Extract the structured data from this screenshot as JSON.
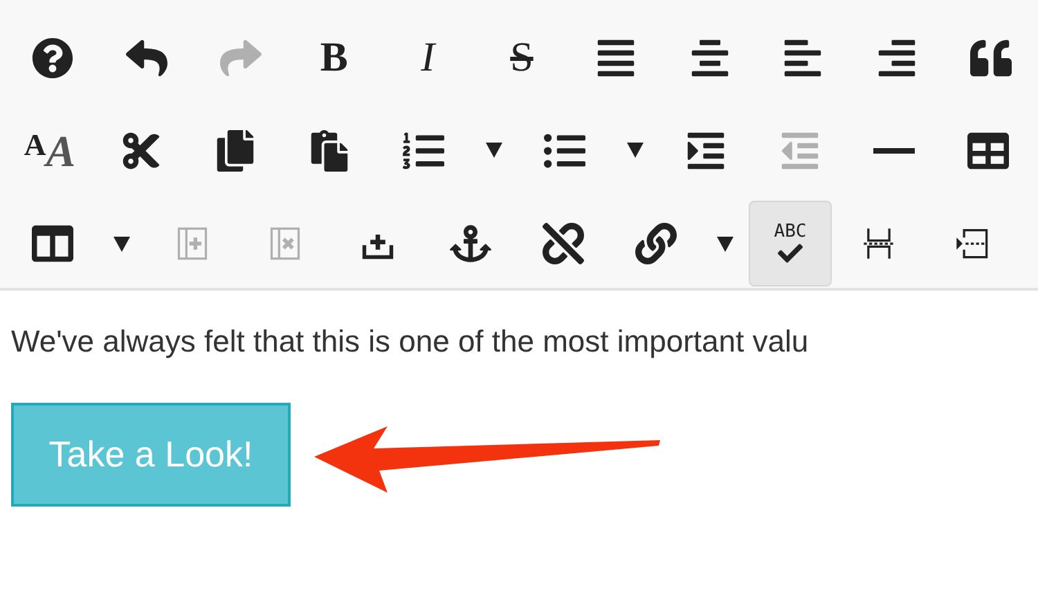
{
  "toolbar": {
    "rows": [
      [
        {
          "kind": "icon",
          "disabled": false,
          "pressed": false
        },
        {
          "kind": "icon",
          "disabled": false,
          "pressed": false
        },
        {
          "kind": "icon",
          "disabled": true,
          "pressed": false
        },
        {
          "kind": "glyph",
          "glyph": "B",
          "disabled": false,
          "pressed": false
        },
        {
          "kind": "glyph",
          "glyph": "I",
          "disabled": false,
          "pressed": false
        },
        {
          "kind": "glyph",
          "glyph": "S",
          "disabled": false,
          "pressed": false
        },
        {
          "kind": "icon",
          "disabled": false,
          "pressed": false
        },
        {
          "kind": "icon",
          "disabled": false,
          "pressed": false
        },
        {
          "kind": "icon",
          "disabled": false,
          "pressed": false
        },
        {
          "kind": "icon",
          "disabled": false,
          "pressed": false
        },
        {
          "kind": "icon",
          "disabled": false,
          "pressed": false
        }
      ],
      [
        {
          "kind": "glyph",
          "glyph": "AA",
          "disabled": false,
          "pressed": false
        },
        {
          "kind": "icon",
          "disabled": false,
          "pressed": false
        },
        {
          "kind": "icon",
          "disabled": false,
          "pressed": false
        },
        {
          "kind": "icon",
          "disabled": false,
          "pressed": false
        },
        {
          "kind": "icon",
          "disabled": false,
          "pressed": false
        },
        {
          "kind": "dropdown",
          "disabled": false,
          "pressed": false
        },
        {
          "kind": "icon",
          "disabled": false,
          "pressed": false
        },
        {
          "kind": "dropdown",
          "disabled": false,
          "pressed": false
        },
        {
          "kind": "icon",
          "disabled": false,
          "pressed": false
        },
        {
          "kind": "icon",
          "disabled": true,
          "pressed": false
        },
        {
          "kind": "icon",
          "disabled": false,
          "pressed": false
        },
        {
          "kind": "icon",
          "disabled": false,
          "pressed": false
        }
      ],
      [
        {
          "kind": "icon",
          "disabled": false,
          "pressed": false
        },
        {
          "kind": "dropdown",
          "disabled": false,
          "pressed": false
        },
        {
          "kind": "icon",
          "disabled": true,
          "pressed": false
        },
        {
          "kind": "icon",
          "disabled": true,
          "pressed": false
        },
        {
          "kind": "icon",
          "disabled": false,
          "pressed": false
        },
        {
          "kind": "icon",
          "disabled": false,
          "pressed": false
        },
        {
          "kind": "icon",
          "disabled": false,
          "pressed": false
        },
        {
          "kind": "icon",
          "disabled": false,
          "pressed": false
        },
        {
          "kind": "dropdown",
          "disabled": false,
          "pressed": false
        },
        {
          "kind": "glyph",
          "glyph": "ABC",
          "disabled": false,
          "pressed": true
        },
        {
          "kind": "icon",
          "disabled": false,
          "pressed": false
        },
        {
          "kind": "icon",
          "disabled": false,
          "pressed": false
        }
      ]
    ]
  },
  "content": {
    "paragraph": "We've always felt that this is one of the most important valu",
    "button": "Take a Look!"
  }
}
